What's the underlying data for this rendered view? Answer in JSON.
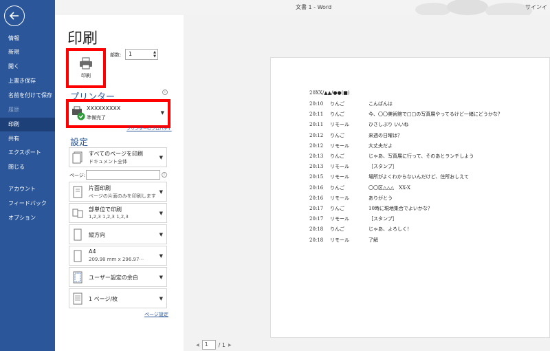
{
  "window": {
    "title": "文書 1  -  Word",
    "signin": "サインイ"
  },
  "sidebar": {
    "items": [
      {
        "label": "情報",
        "state": "normal"
      },
      {
        "label": "新規",
        "state": "normal"
      },
      {
        "label": "開く",
        "state": "normal"
      },
      {
        "label": "上書き保存",
        "state": "normal"
      },
      {
        "label": "名前を付けて保存",
        "state": "normal"
      },
      {
        "label": "履歴",
        "state": "disabled"
      },
      {
        "label": "印刷",
        "state": "active"
      },
      {
        "label": "共有",
        "state": "normal"
      },
      {
        "label": "エクスポート",
        "state": "normal"
      },
      {
        "label": "閉じる",
        "state": "normal"
      },
      {
        "label": "アカウント",
        "state": "normal"
      },
      {
        "label": "フィードバック",
        "state": "normal"
      },
      {
        "label": "オプション",
        "state": "normal"
      }
    ]
  },
  "print": {
    "heading": "印刷",
    "print_button": "印刷",
    "copies_label": "部数:",
    "copies_value": "1"
  },
  "printer": {
    "section_title": "プリンター",
    "name": "XXXXXXXXX",
    "status": "準備完了",
    "properties_link": "プリンターのプロパティ"
  },
  "settings": {
    "section_title": "設定",
    "pages_label": "ページ:",
    "items": [
      {
        "line1": "すべてのページを印刷",
        "line2": "ドキュメント全体"
      },
      {
        "line1": "片面印刷",
        "line2": "ページの片面のみを印刷します"
      },
      {
        "line1": "部単位で印刷",
        "line2": "1,2,3     1,2,3     1,2,3"
      },
      {
        "line1": "縦方向",
        "line2": ""
      },
      {
        "line1": "A4",
        "line2": "209.98 mm x 296.97···"
      },
      {
        "line1": "ユーザー設定の余白",
        "line2": ""
      },
      {
        "line1": "1 ページ/枚",
        "line2": ""
      }
    ],
    "page_setup_link": "ページ設定"
  },
  "document": {
    "header": "20XX/▲▲/●●(■)",
    "lines": [
      {
        "time": "20:10",
        "name": "りんご",
        "text": "こんばんは"
      },
      {
        "time": "20:11",
        "name": "りんご",
        "text": "今、〇〇美術館で□□の写真展やってるけど一緒にどうかな？"
      },
      {
        "time": "20:11",
        "name": "リモール",
        "text": "ひさしぶり いいね"
      },
      {
        "time": "20:12",
        "name": "りんご",
        "text": "来週の日曜は？"
      },
      {
        "time": "20:12",
        "name": "リモール",
        "text": "大丈夫だよ"
      },
      {
        "time": "20:13",
        "name": "りんご",
        "text": "じゃあ、写真展に行って、そのあとランチしよう"
      },
      {
        "time": "20:13",
        "name": "リモール",
        "text": "［スタンプ］"
      },
      {
        "time": "20:15",
        "name": "リモール",
        "text": "場所がよくわからないんだけど、住所おしえて"
      },
      {
        "time": "20:16",
        "name": "りんご",
        "text": "〇〇区△△△　XX-X"
      },
      {
        "time": "20:16",
        "name": "リモール",
        "text": "ありがとう"
      },
      {
        "time": "20:17",
        "name": "りんご",
        "text": "10時に現地集合でよいかな？"
      },
      {
        "time": "20:17",
        "name": "リモール",
        "text": "［スタンプ］"
      },
      {
        "time": "20:18",
        "name": "りんご",
        "text": "じゃあ、よろしく！"
      },
      {
        "time": "20:18",
        "name": "リモール",
        "text": "了解"
      }
    ]
  },
  "pager": {
    "current": "1",
    "total": "/ 1"
  },
  "colors": {
    "sidebar": "#2b579a",
    "sidebar_active": "#1e4078",
    "highlight": "#ff0000"
  }
}
